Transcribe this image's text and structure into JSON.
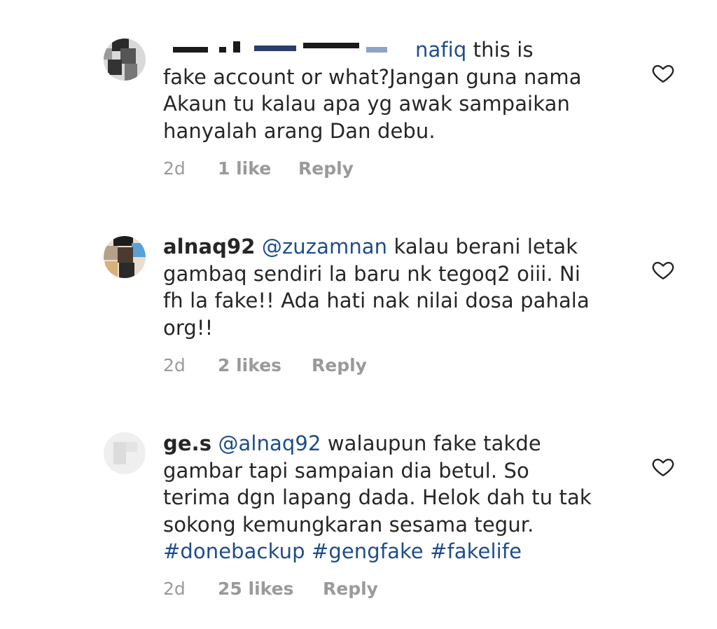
{
  "comments": [
    {
      "username_tail": "nafiq",
      "mention": "",
      "line1_rest": " this is",
      "lines": [
        "fake account or what?Jangan guna nama",
        "Akaun tu kalau apa yg awak sampaikan",
        "hanyalah arang Dan debu."
      ],
      "hashtags": [],
      "time": "2d",
      "likes": "1 like",
      "reply": "Reply"
    },
    {
      "username_tail": "alnaq92",
      "mention": "@zuzamnan",
      "line1_rest": " kalau berani letak",
      "lines": [
        "gambaq sendiri la baru nk tegoq2 oiii. Ni",
        "fh la fake!! Ada hati nak nilai dosa pahala",
        "org!!"
      ],
      "hashtags": [],
      "time": "2d",
      "likes": "2 likes",
      "reply": "Reply"
    },
    {
      "username_tail": "ge.s",
      "mention": "@alnaq92",
      "line1_rest": " walaupun fake takde",
      "lines": [
        "gambar tapi sampaian dia betul. So",
        "terima dgn lapang dada. Helok dah tu tak",
        "sokong kemungkaran sesama tegur."
      ],
      "hashtags": [
        "#donebackup",
        "#gengfake",
        "#fakelife"
      ],
      "time": "2d",
      "likes": "25 likes",
      "reply": "Reply"
    }
  ],
  "icons": {
    "like": "heart-outline-icon"
  },
  "colors": {
    "link": "#1f4d8a",
    "meta": "#9a9a9a",
    "text": "#262626"
  }
}
